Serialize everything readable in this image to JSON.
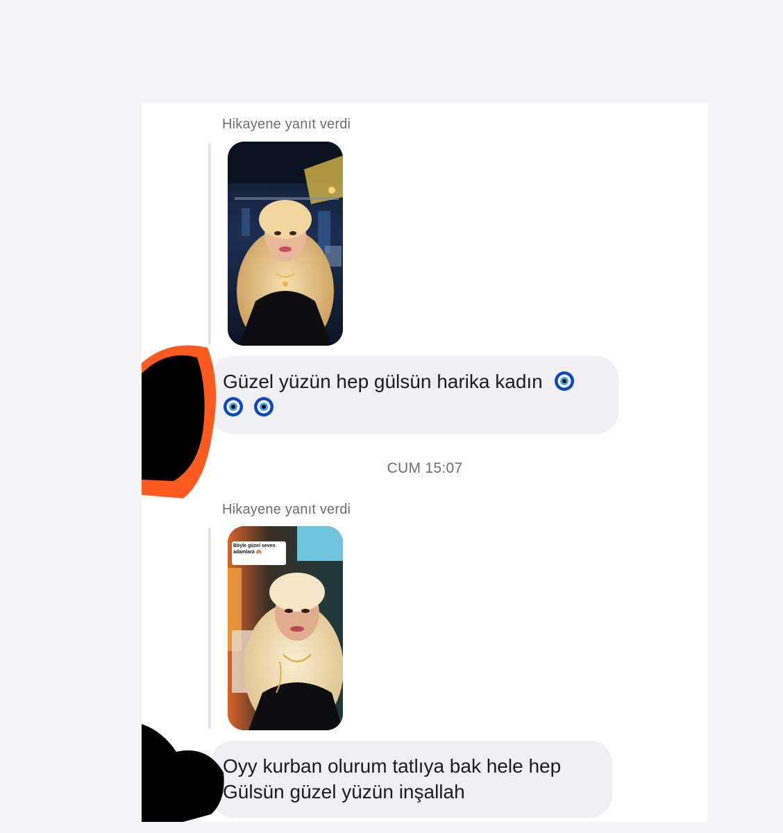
{
  "thread": {
    "messages": [
      {
        "reply_label": "Hikayene yanıt verdi",
        "text_line1": "Güzel yüzün hep gülsün harika kadın",
        "trailing_emoji": "nazar-boncugu",
        "line2_emoji": [
          "nazar-boncugu",
          "nazar-boncugu"
        ]
      },
      {
        "reply_label": "Hikayene yanıt verdi",
        "story_sticker": "Böyle güzel seven adamlara 🙈",
        "text_line1": "Oyy kurban olurum tatlıya bak hele hep",
        "text_line2": "Gülsün güzel yüzün inşallah"
      }
    ],
    "timestamp": "CUM 15:07"
  },
  "colors": {
    "bubble": "#efeff4",
    "redaction_accent": "#ff5a1f",
    "evil_eye_blue": "#0d47c4"
  }
}
